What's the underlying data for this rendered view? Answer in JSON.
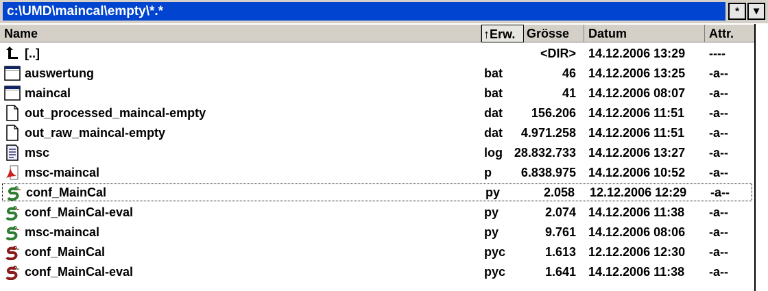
{
  "path": "c:\\UMD\\maincal\\empty\\*.*",
  "path_buttons": {
    "star": "*",
    "dropdown": "▼"
  },
  "columns": {
    "name": "Name",
    "ext": "↑Erw.",
    "size": "Grösse",
    "date": "Datum",
    "attr": "Attr."
  },
  "rows": [
    {
      "icon": "parent-dir-icon",
      "name": "[..]",
      "ext": "",
      "size": "<DIR>",
      "date": "14.12.2006 13:29",
      "attr": "----"
    },
    {
      "icon": "batch-window-icon",
      "name": "auswertung",
      "ext": "bat",
      "size": "46",
      "date": "14.12.2006 13:25",
      "attr": "-a--"
    },
    {
      "icon": "batch-window-icon",
      "name": "maincal",
      "ext": "bat",
      "size": "41",
      "date": "14.12.2006 08:07",
      "attr": "-a--"
    },
    {
      "icon": "blank-file-icon",
      "name": "out_processed_maincal-empty",
      "ext": "dat",
      "size": "156.206",
      "date": "14.12.2006 11:51",
      "attr": "-a--"
    },
    {
      "icon": "blank-file-icon",
      "name": "out_raw_maincal-empty",
      "ext": "dat",
      "size": "4.971.258",
      "date": "14.12.2006 11:51",
      "attr": "-a--"
    },
    {
      "icon": "text-file-icon",
      "name": "msc",
      "ext": "log",
      "size": "28.832.733",
      "date": "14.12.2006 13:27",
      "attr": "-a--"
    },
    {
      "icon": "pdf-file-icon",
      "name": "msc-maincal",
      "ext": "p",
      "size": "6.838.975",
      "date": "14.12.2006 10:52",
      "attr": "-a--"
    },
    {
      "icon": "python-source-icon",
      "name": "conf_MainCal",
      "ext": "py",
      "size": "2.058",
      "date": "12.12.2006 12:29",
      "attr": "-a--"
    },
    {
      "icon": "python-source-icon",
      "name": "conf_MainCal-eval",
      "ext": "py",
      "size": "2.074",
      "date": "14.12.2006 11:38",
      "attr": "-a--"
    },
    {
      "icon": "python-source-icon",
      "name": "msc-maincal",
      "ext": "py",
      "size": "9.761",
      "date": "14.12.2006 08:06",
      "attr": "-a--"
    },
    {
      "icon": "python-compiled-icon",
      "name": "conf_MainCal",
      "ext": "pyc",
      "size": "1.613",
      "date": "12.12.2006 12:30",
      "attr": "-a--"
    },
    {
      "icon": "python-compiled-icon",
      "name": "conf_MainCal-eval",
      "ext": "pyc",
      "size": "1.641",
      "date": "14.12.2006 11:38",
      "attr": "-a--"
    }
  ],
  "focused_row": 7,
  "colors": {
    "path_bg": "#0044d0",
    "header_bg": "#d4d0c8",
    "python_green": "#2e7d32",
    "python_red": "#8b1a1a"
  }
}
